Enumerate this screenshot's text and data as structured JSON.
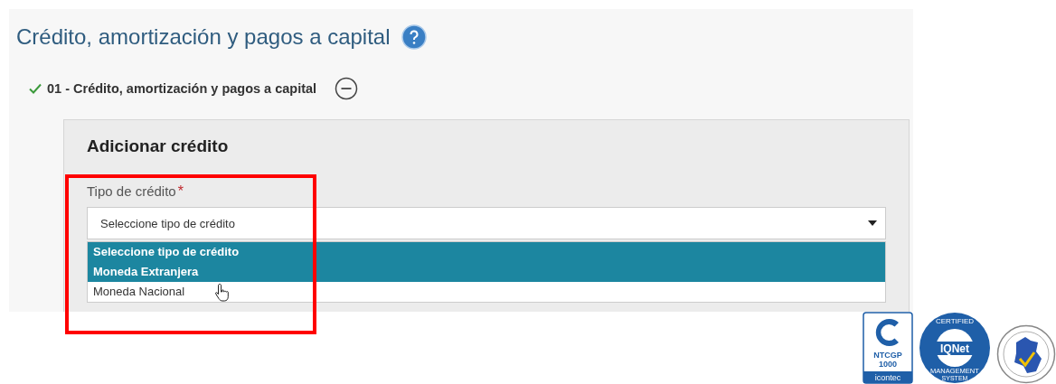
{
  "page_title": "Crédito, amortización y pagos a capital",
  "section": {
    "label": "01 - Crédito, amortización y pagos a capital",
    "completed": true,
    "expanded": true
  },
  "panel": {
    "title": "Adicionar crédito",
    "field": {
      "label": "Tipo de crédito",
      "required_mark": "*",
      "value": "Seleccione tipo de crédito",
      "open": true,
      "options": [
        {
          "label": "Seleccione tipo de crédito",
          "highlighted": true
        },
        {
          "label": "Moneda Extranjera",
          "highlighted": true
        },
        {
          "label": "Moneda Nacional",
          "highlighted": false
        }
      ]
    }
  },
  "logos": [
    {
      "kind": "ntcgp",
      "texts": [
        "NTCGP",
        "1000",
        "icontec"
      ]
    },
    {
      "kind": "iqnet",
      "texts": [
        "CERTIFIED",
        "IQNet",
        "MANAGEMENT",
        "SYSTEM"
      ]
    },
    {
      "kind": "map"
    }
  ]
}
